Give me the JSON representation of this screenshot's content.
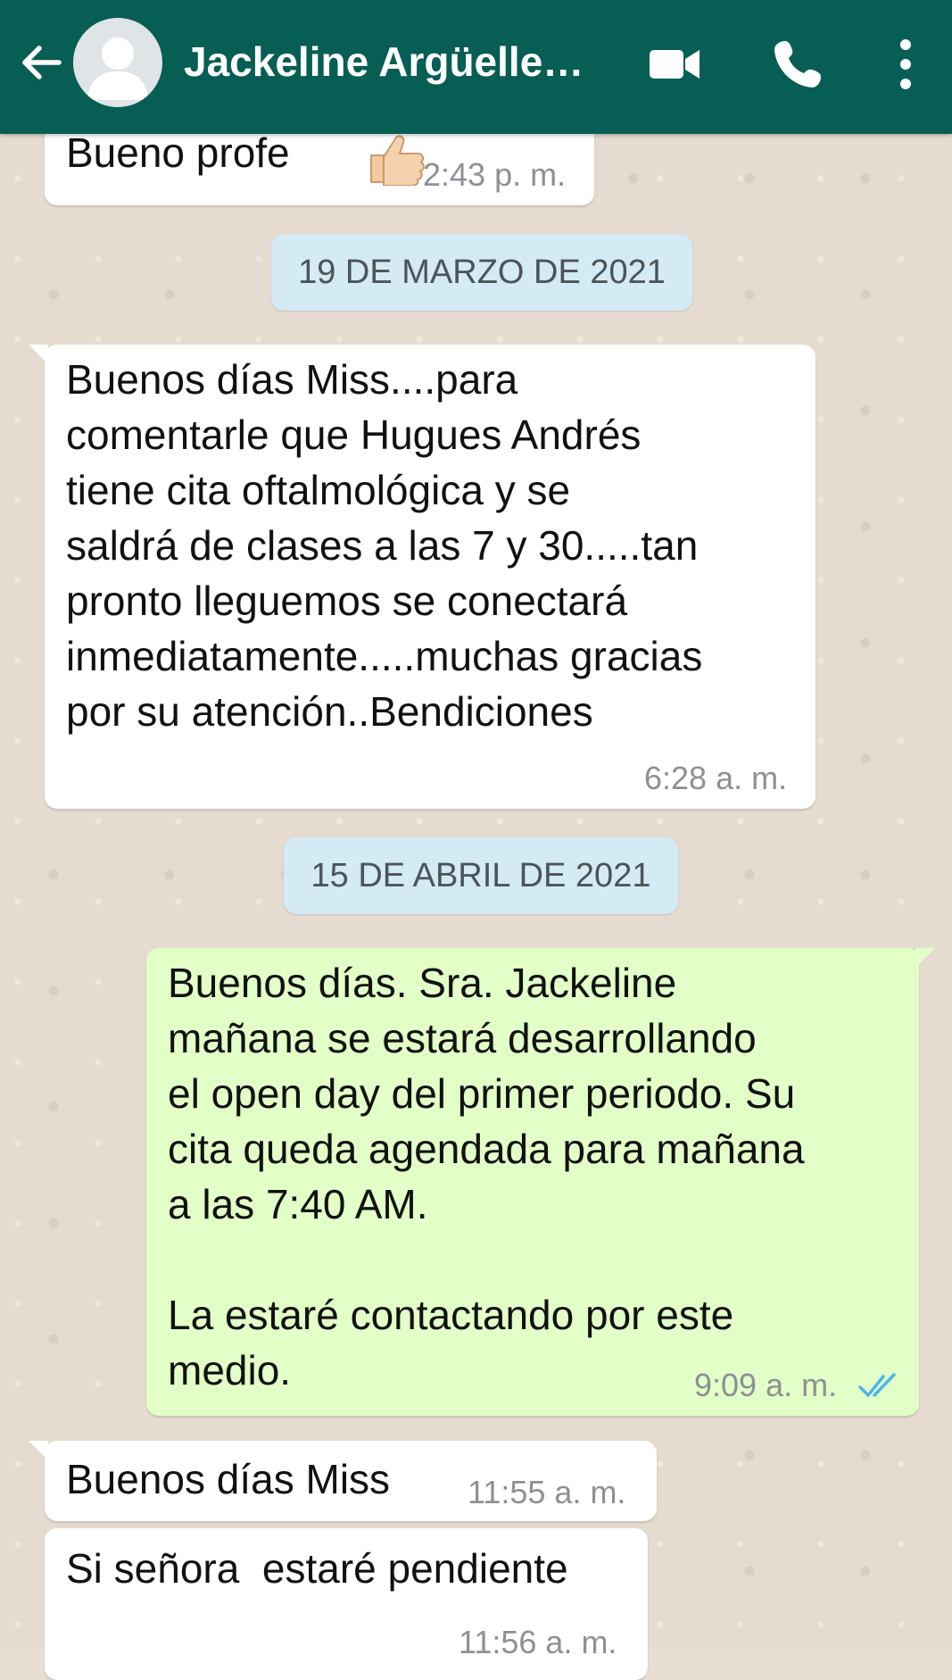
{
  "header": {
    "contact_name": "Jackeline Argüelle…",
    "icons": {
      "back": "arrow-back-icon",
      "video": "video-call-icon",
      "call": "phone-icon",
      "menu": "more-vert-icon",
      "avatar": "default-avatar-icon"
    },
    "colors": {
      "bar": "#075e54",
      "icon": "#ffffff"
    }
  },
  "messages": [
    {
      "direction": "in",
      "text": "Bueno profe",
      "emoji": "thumbs-up",
      "time": "2:43 p. m."
    },
    {
      "type": "date",
      "label": "19 DE MARZO DE 2021"
    },
    {
      "direction": "in",
      "text": "Buenos días Miss....para\ncomentarle que Hugues Andrés\ntiene cita oftalmológica y se\nsaldrá de clases a las 7 y 30.....tan\npronto lleguemos se conectará\ninmediatamente.....muchas gracias\npor su atención..Bendiciones",
      "time": "6:28 a. m."
    },
    {
      "type": "date",
      "label": "15 DE ABRIL DE 2021"
    },
    {
      "direction": "out",
      "text": "Buenos días. Sra. Jackeline\nmañana se estará desarrollando\nel open day del primer periodo. Su\ncita queda agendada para mañana\na las 7:40 AM.\n\nLa estaré contactando por este\nmedio.",
      "time": "9:09 a. m.",
      "status": "read-double-check"
    },
    {
      "direction": "in",
      "text": "Buenos días Miss",
      "time": "11:55 a. m."
    },
    {
      "direction": "in",
      "text": "Si señora  estaré pendiente",
      "time": "11:56 a. m."
    }
  ],
  "colors": {
    "incoming": "#ffffff",
    "outgoing": "#e2ffc7",
    "date_chip": "#d4eaf4",
    "read_check": "#4fb6ec"
  }
}
